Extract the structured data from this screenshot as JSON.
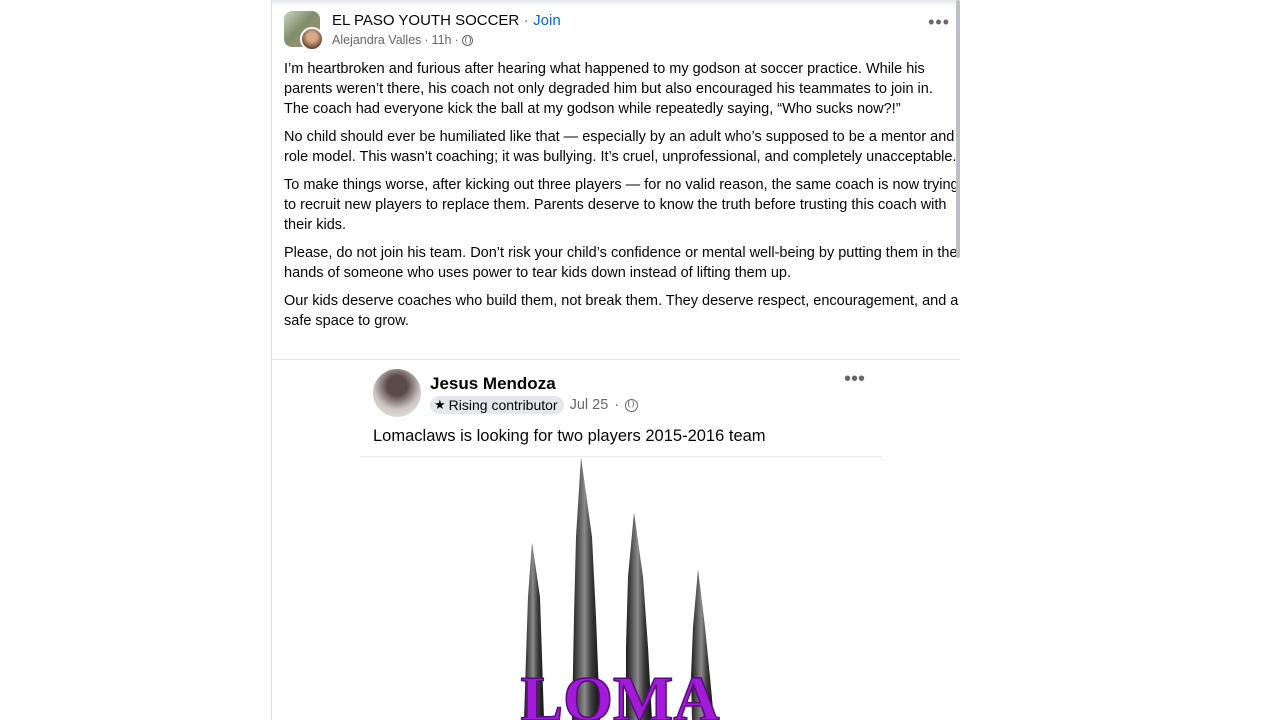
{
  "post": {
    "group_name": "EL PASO YOUTH SOCCER",
    "separator": "·",
    "join_label": "Join",
    "author": "Alejandra Valles",
    "time": "11h",
    "meta_sep": "·",
    "paragraphs": [
      "I’m heartbroken and furious after hearing what happened to my godson at soccer practice. While his parents weren’t there, his coach not only degraded him but also encouraged his teammates to join in. The coach had everyone kick the ball at my godson while repeatedly saying, “Who sucks now?!”",
      "No child should ever be humiliated like that — especially by an adult who’s supposed to be a mentor and role model. This wasn’t coaching; it was bullying. It’s cruel, unprofessional, and completely unacceptable.",
      "To make things worse, after kicking out three players — for no valid reason, the same coach is now trying to recruit new players to replace them. Parents deserve to know the truth before trusting this coach with their kids.",
      "Please, do not join his team. Don’t risk your child’s confidence or mental well-being by putting them in the hands of someone who uses power to tear kids down instead of lifting them up.",
      "Our kids deserve coaches who build them, not break them. They deserve respect, encouragement, and a safe space to grow."
    ],
    "more_label": "•••"
  },
  "shared_post": {
    "name": "Jesus Mendoza",
    "badge": "Rising contributor",
    "date": "Jul 25",
    "date_sep": "·",
    "text": "Lomaclaws is looking for two players 2015-2016 team",
    "more_label": "•••",
    "logo_text": "LOMA"
  },
  "icons": {
    "globe": "globe-icon",
    "star": "star-icon",
    "more": "more-options-icon"
  },
  "colors": {
    "link": "#0064d1",
    "secondary_text": "#65676b",
    "logo_purple": "#a21bd8"
  }
}
